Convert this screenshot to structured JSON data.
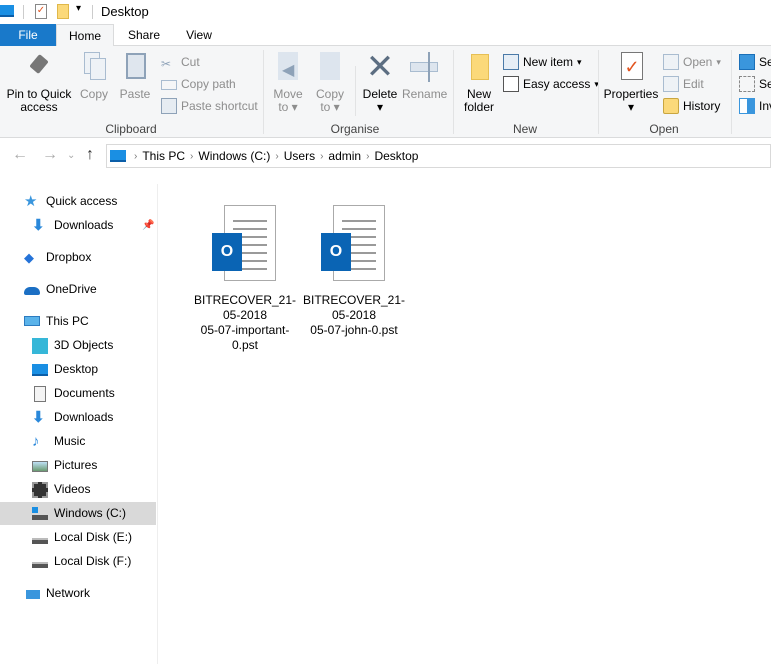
{
  "window": {
    "title": "Desktop"
  },
  "tabs": [
    "File",
    "Home",
    "Share",
    "View"
  ],
  "ribbon": {
    "clipboard": {
      "label": "Clipboard",
      "pin": "Pin to Quick access",
      "pin1": "Pin to Quick",
      "pin2": "access",
      "copy": "Copy",
      "paste": "Paste",
      "cut": "Cut",
      "copy_path": "Copy path",
      "paste_shortcut": "Paste shortcut"
    },
    "organise": {
      "label": "Organise",
      "move1": "Move",
      "move2": "to",
      "copy1": "Copy",
      "copy2": "to",
      "delete": "Delete",
      "rename": "Rename"
    },
    "new": {
      "label": "New",
      "new_folder1": "New",
      "new_folder2": "folder",
      "new_item": "New item",
      "easy_access": "Easy access"
    },
    "open": {
      "label": "Open",
      "properties": "Properties",
      "open": "Open",
      "edit": "Edit",
      "history": "History"
    },
    "select": {
      "select_all": "Se",
      "select_none": "Se",
      "invert": "Inv"
    }
  },
  "address": {
    "crumbs": [
      "This PC",
      "Windows (C:)",
      "Users",
      "admin",
      "Desktop"
    ]
  },
  "sidebar": {
    "items": [
      {
        "label": "Quick access",
        "icon": "star-icon"
      },
      {
        "label": "Downloads",
        "icon": "download-icon"
      },
      {
        "label": "Dropbox",
        "icon": "dropbox-icon"
      },
      {
        "label": "OneDrive",
        "icon": "cloud-icon"
      },
      {
        "label": "This PC",
        "icon": "computer-icon"
      },
      {
        "label": "3D Objects",
        "icon": "cube-icon"
      },
      {
        "label": "Desktop",
        "icon": "desktop-icon"
      },
      {
        "label": "Documents",
        "icon": "document-icon"
      },
      {
        "label": "Downloads",
        "icon": "download-icon"
      },
      {
        "label": "Music",
        "icon": "music-icon"
      },
      {
        "label": "Pictures",
        "icon": "picture-icon"
      },
      {
        "label": "Videos",
        "icon": "film-icon"
      },
      {
        "label": "Windows (C:)",
        "icon": "drive-icon"
      },
      {
        "label": "Local Disk (E:)",
        "icon": "drive-icon"
      },
      {
        "label": "Local Disk (F:)",
        "icon": "drive-icon"
      },
      {
        "label": "Network",
        "icon": "network-icon"
      }
    ]
  },
  "files": [
    {
      "l1": "BITRECOVER_21-",
      "l2": "05-2018",
      "l3": "05-07-important-",
      "l4": "0.pst"
    },
    {
      "l1": "BITRECOVER_21-",
      "l2": "05-2018",
      "l3": "05-07-john-0.pst",
      "l4": ""
    }
  ],
  "colors": {
    "accent": "#1979ca",
    "outlook": "#0a64b4",
    "selected": "#d9d9d9"
  }
}
